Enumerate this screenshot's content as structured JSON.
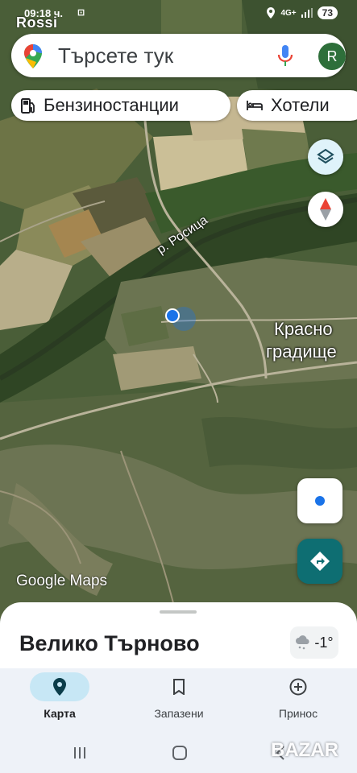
{
  "status_bar": {
    "time": "09:18 ч.",
    "network": "4G+",
    "battery": "73"
  },
  "watermark_top": "Rossi",
  "search": {
    "placeholder": "Търсете тук",
    "avatar_letter": "R"
  },
  "chips": [
    {
      "label": "Бензиностанции",
      "icon": "gas-station-icon"
    },
    {
      "label": "Хотели",
      "icon": "hotel-bed-icon"
    }
  ],
  "map": {
    "river_label": "р. Росица",
    "village_label_line1": "Красно",
    "village_label_line2": "градище",
    "attribution": "Google Maps"
  },
  "sheet": {
    "place_name": "Велико Търново",
    "temperature": "-1°",
    "weather_icon": "cloud-snow-icon"
  },
  "bottom_nav": [
    {
      "label": "Карта",
      "icon": "map-pin-icon",
      "active": true
    },
    {
      "label": "Запазени",
      "icon": "bookmark-icon",
      "active": false
    },
    {
      "label": "Принос",
      "icon": "add-circle-icon",
      "active": false
    }
  ],
  "watermark_bottom": "BAZAR",
  "colors": {
    "accent": "#0e6e72",
    "nav_active": "#c7e7f5",
    "location_blue": "#1a73e8"
  }
}
